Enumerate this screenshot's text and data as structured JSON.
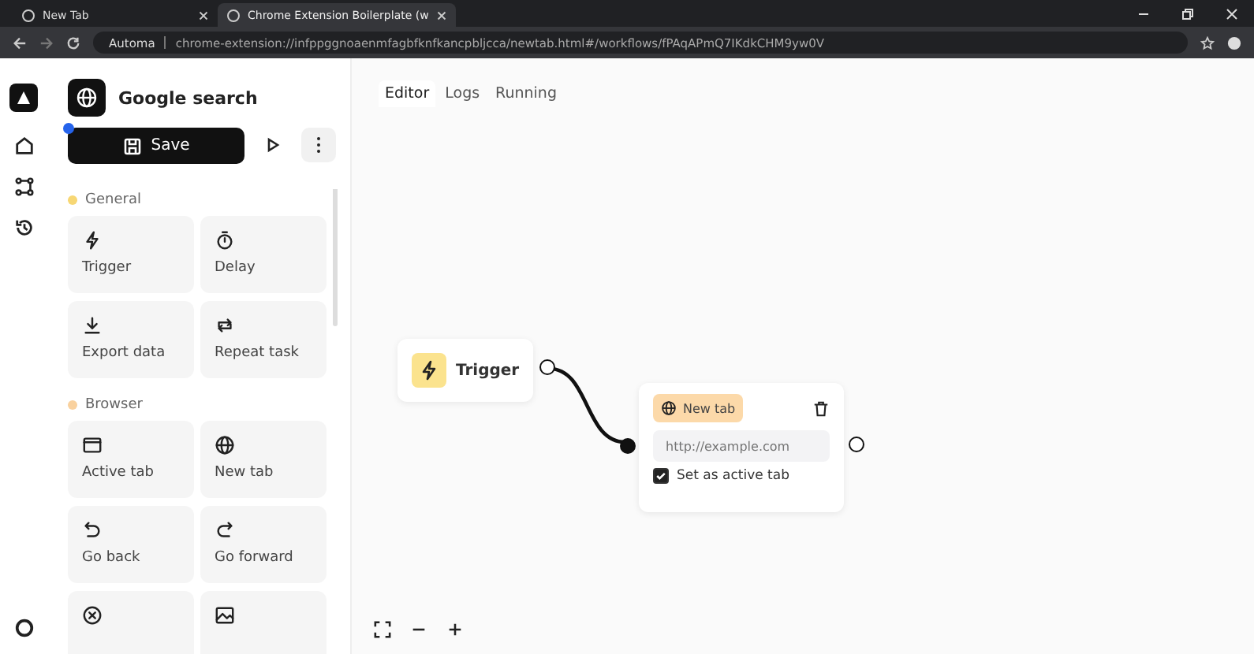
{
  "browser": {
    "tabs": [
      {
        "title": "New Tab",
        "selected": false
      },
      {
        "title": "Chrome Extension Boilerplate (w",
        "selected": true
      }
    ],
    "site_label": "Automa",
    "url": "chrome-extension://infppggnoaenmfagbfknfkancpbljcca/newtab.html#/workflows/fPAqAPmQ7IKdkCHM9yw0V"
  },
  "workflow": {
    "name": "Google search",
    "save_label": "Save",
    "unsaved": true
  },
  "categories": [
    {
      "name": "General",
      "color": "#f7d774",
      "items": [
        {
          "kind": "bolt",
          "label": "Trigger"
        },
        {
          "kind": "timer",
          "label": "Delay"
        },
        {
          "kind": "download",
          "label": "Export data"
        },
        {
          "kind": "repeat",
          "label": "Repeat task"
        }
      ]
    },
    {
      "name": "Browser",
      "color": "#f9d19e",
      "items": [
        {
          "kind": "window",
          "label": "Active tab"
        },
        {
          "kind": "globe",
          "label": "New tab"
        },
        {
          "kind": "undo",
          "label": "Go back"
        },
        {
          "kind": "redo",
          "label": "Go forward"
        },
        {
          "kind": "xcircle"
        },
        {
          "kind": "image"
        }
      ]
    }
  ],
  "editor_tabs": [
    {
      "label": "Editor",
      "selected": true
    },
    {
      "label": "Logs",
      "selected": false
    },
    {
      "label": "Running",
      "selected": false
    }
  ],
  "nodes": {
    "trigger": {
      "label": "Trigger"
    },
    "new_tab": {
      "label": "New tab",
      "url_placeholder": "http://example.com",
      "active_label": "Set as active tab",
      "checked": true
    }
  }
}
